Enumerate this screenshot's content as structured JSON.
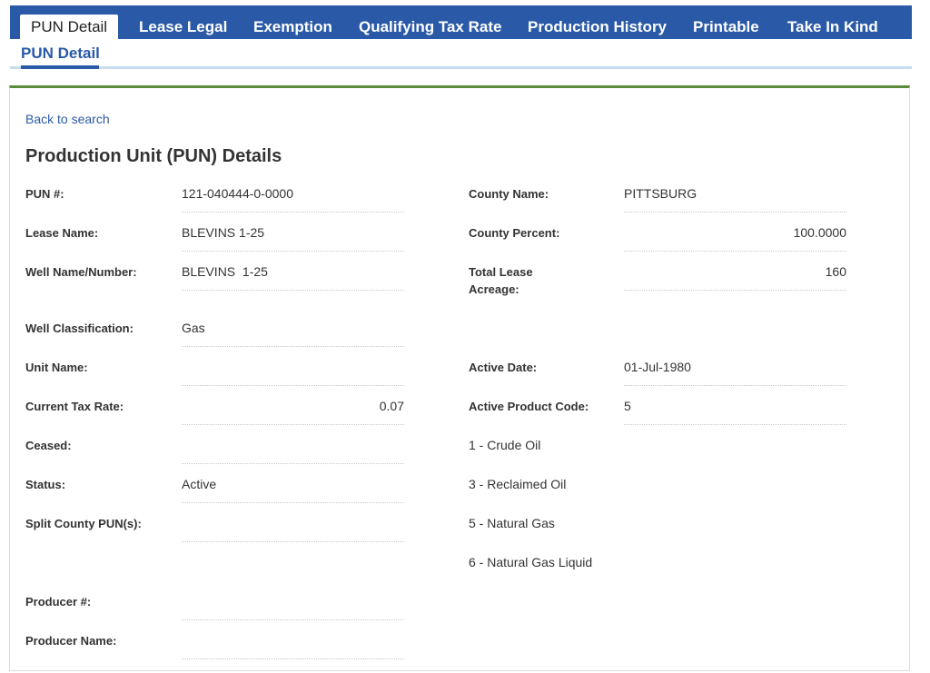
{
  "tabs": [
    {
      "label": "PUN Detail"
    },
    {
      "label": "Lease Legal"
    },
    {
      "label": "Exemption"
    },
    {
      "label": "Qualifying Tax Rate"
    },
    {
      "label": "Production History"
    },
    {
      "label": "Printable"
    },
    {
      "label": "Take In Kind"
    }
  ],
  "subtab": {
    "label": "PUN Detail"
  },
  "back_link": "Back to search",
  "section_title": "Production Unit (PUN) Details",
  "left_fields": {
    "pun": {
      "label": "PUN #:",
      "value": "121-040444-0-0000"
    },
    "lease_name": {
      "label": "Lease Name:",
      "value": "BLEVINS 1-25"
    },
    "well_name": {
      "label": "Well Name/Number:",
      "value": "BLEVINS  1-25"
    },
    "well_class": {
      "label": "Well Classification:",
      "value": "Gas"
    },
    "unit_name": {
      "label": "Unit Name:",
      "value": ""
    },
    "tax_rate": {
      "label": "Current Tax Rate:",
      "value": "0.07"
    },
    "ceased": {
      "label": "Ceased:",
      "value": ""
    },
    "status": {
      "label": "Status:",
      "value": "Active"
    },
    "split_county": {
      "label": "Split County PUN(s):",
      "value": ""
    },
    "producer_num": {
      "label": "Producer #:",
      "value": ""
    },
    "producer_name": {
      "label": "Producer Name:",
      "value": ""
    }
  },
  "right_fields": {
    "county_name": {
      "label": "County Name:",
      "value": "PITTSBURG"
    },
    "county_pct": {
      "label": "County Percent:",
      "value": "100.0000"
    },
    "lease_acreage": {
      "label_line1": "Total Lease",
      "label_line2": "Acreage:",
      "value": "160"
    },
    "active_date": {
      "label": "Active Date:",
      "value": "01-Jul-1980"
    },
    "product_code": {
      "label": "Active Product Code:",
      "value": "5"
    }
  },
  "product_legend": [
    "1 - Crude Oil",
    "3 - Reclaimed Oil",
    "5 - Natural Gas",
    "6 - Natural Gas Liquid"
  ]
}
